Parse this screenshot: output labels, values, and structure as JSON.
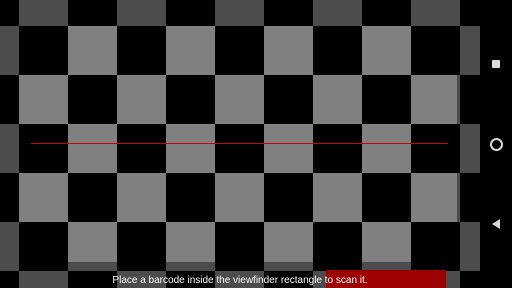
{
  "scanner": {
    "status_message": "Place a barcode inside the viewfinder rectangle to scan it.",
    "laser_color": "#cc0000",
    "result_tab_color": "#9e0000"
  },
  "navigation_bar": {
    "buttons": [
      {
        "name": "recents",
        "icon": "square-icon"
      },
      {
        "name": "home",
        "icon": "circle-icon"
      },
      {
        "name": "back",
        "icon": "triangle-left-icon"
      }
    ]
  }
}
